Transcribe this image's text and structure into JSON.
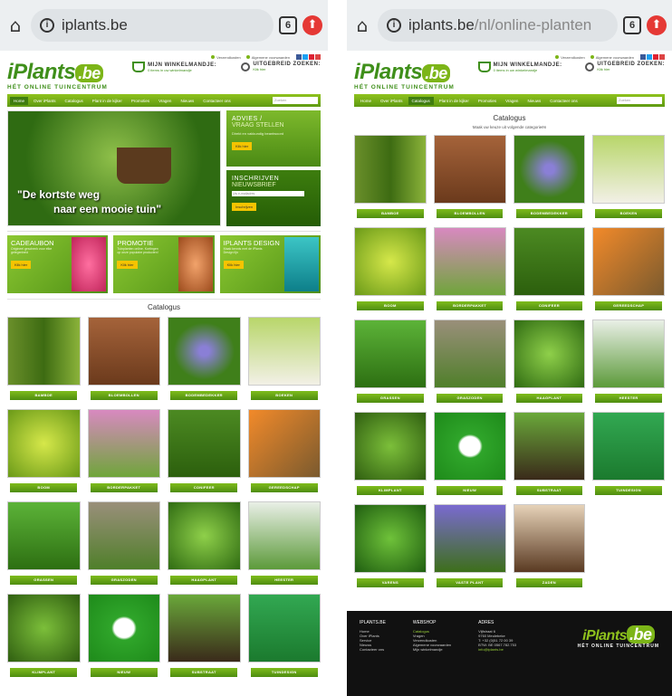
{
  "left": {
    "browser": {
      "domain": "iplants.be",
      "path": "",
      "tabs_count": "6"
    },
    "topbar": {
      "links": [
        "Verzendkosten",
        "Algemene voorwaarden"
      ]
    },
    "logo": {
      "brand": "iPlants",
      "tld": ".be",
      "tagline": "HÉT ONLINE TUINCENTRUM"
    },
    "cart": {
      "title": "MIJN WINKELMANDJE:",
      "sub": "0 items in uw winkelmandje"
    },
    "search": {
      "title": "UITGEBREID ZOEKEN:",
      "sub": "Klik hier"
    },
    "nav": {
      "items": [
        "Home",
        "Over iPlants",
        "Catalogus",
        "Plant in de kijker",
        "Promoties",
        "Vragen",
        "Nieuws",
        "Contacteer ons"
      ],
      "search_placeholder": "Zoeken"
    },
    "hero": {
      "quote_line1": "\"De kortste weg",
      "quote_line2": "naar een mooie tuin\""
    },
    "advies": {
      "title": "ADVIES /",
      "subtitle": "VRAAG STELLEN",
      "text": "Direkt en vakkundig beantwoord",
      "button": "Klik hier"
    },
    "newsletter": {
      "title": "INSCHRIJVEN",
      "subtitle": "NIEUWSBRIEF",
      "placeholder": "Uw e-mailadres",
      "button": "Inschrijven"
    },
    "promos": [
      {
        "title": "CADEAUBON",
        "text": "Origineel geschenk voor elke gelegenheid",
        "button": "Klik hier"
      },
      {
        "title": "PROMOTIE",
        "text": "Tuinplanten online. Kortingen op onze populaire producten!",
        "button": "Klik hier"
      },
      {
        "title": "IPLANTS DESIGN",
        "text": "Maak kennis met de iPlants Design lijn",
        "button": "Klik hier"
      }
    ],
    "catalog_title": "Catalogus",
    "categories": [
      "BAMBOE",
      "BLOEMBOLLEN",
      "BODEMBEDEKKER",
      "BOEKEN",
      "BOOM",
      "BORDERPAKKET",
      "CONIFEER",
      "GEREEDSCHAP",
      "GRASSEN",
      "GRASZODEN",
      "HAAGPLANT",
      "HEESTER",
      "KLIMPLANT",
      "NIEUW",
      "SUBSTRAAT",
      "TUINDESIGN"
    ]
  },
  "right": {
    "browser": {
      "domain": "iplants.be",
      "path": "/nl/online-planten",
      "tabs_count": "6"
    },
    "topbar": {
      "links": [
        "Verzendkosten",
        "Algemene voorwaarden"
      ]
    },
    "logo": {
      "brand": "iPlants",
      "tld": ".be",
      "tagline": "HÉT ONLINE TUINCENTRUM"
    },
    "cart": {
      "title": "MIJN WINKELMANDJE:",
      "sub": "0 items in uw winkelmandje"
    },
    "search": {
      "title": "UITGEBREID ZOEKEN:",
      "sub": "Klik hier"
    },
    "nav": {
      "items": [
        "Home",
        "Over iPlants",
        "Catalogus",
        "Plant in de kijker",
        "Promoties",
        "Vragen",
        "Nieuws",
        "Contacteer ons"
      ],
      "search_placeholder": "Zoeken"
    },
    "catalog_title": "Catalogus",
    "catalog_sub": "Maak uw keuze uit volgende categorieën",
    "categories": [
      "BAMBOE",
      "BLOEMBOLLEN",
      "BODEMBEDEKKER",
      "BOEKEN",
      "BOOM",
      "BORDERPAKKET",
      "CONIFEER",
      "GEREEDSCHAP",
      "GRASSEN",
      "GRASZODEN",
      "HAAGPLANT",
      "HEESTER",
      "KLIMPLANT",
      "NIEUW",
      "SUBSTRAAT",
      "TUINDESIGN",
      "VARENS",
      "VASTE PLANT",
      "ZADEN"
    ],
    "footer": {
      "col1_title": "IPLANTS.BE",
      "col1_items": [
        "Home",
        "Over iPlants",
        "Service",
        "Nieuws",
        "Contacteer ons"
      ],
      "col2_title": "WEBSHOP",
      "col2_items": [
        "Catalogus",
        "Vragen",
        "Verzendkosten",
        "Algemene voorwaarden",
        "Mijn winkelmandje"
      ],
      "col3_title": "ADRES",
      "col3_items": [
        "Vijfstraat 6",
        "9760 Meulebeke",
        "T: +32 (0)51 72 00 39",
        "BTW: BE 0567.782.753",
        "info@iplants.be"
      ],
      "logo_brand": "iPlants",
      "logo_tld": ".be",
      "logo_tagline": "HÉT ONLINE TUINCENTRUM"
    }
  },
  "colors": {
    "brand_green": "#5e9a12",
    "accent_yellow": "#f5c400",
    "footer_bg": "#111111"
  }
}
